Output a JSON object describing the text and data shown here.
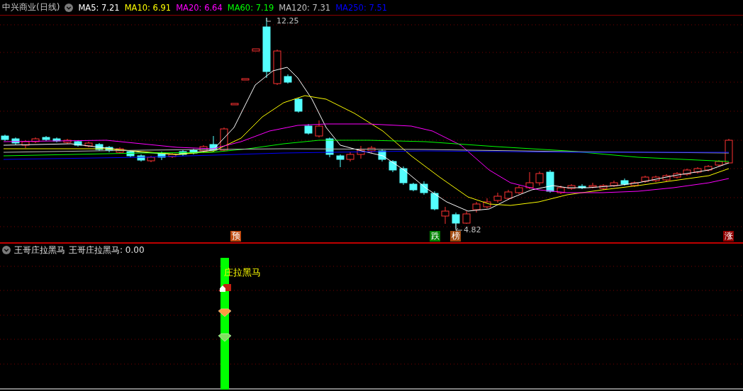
{
  "title": "中兴商业(日线)",
  "ma_legend": [
    {
      "label": "MA5: 7.21",
      "color": "#ffffff"
    },
    {
      "label": "MA10: 6.91",
      "color": "#ffff00"
    },
    {
      "label": "MA20: 6.64",
      "color": "#ff00ff"
    },
    {
      "label": "MA60: 7.19",
      "color": "#00ff00"
    },
    {
      "label": "MA120: 7.31",
      "color": "#c0c0c0"
    },
    {
      "label": "MA250: 7.51",
      "color": "#0000ff"
    }
  ],
  "price_labels": [
    {
      "text": "12.25"
    },
    {
      "text": "4.82"
    }
  ],
  "signal_markers": [
    {
      "text": "预",
      "color": "#c04a10"
    },
    {
      "text": "跌",
      "color": "#008000"
    },
    {
      "text": "榜",
      "color": "#a04a10"
    },
    {
      "text": "涨",
      "color": "#900000"
    }
  ],
  "indicator": {
    "name": "王哥庄拉黑马",
    "value_label": "王哥庄拉黑马: 0.00",
    "bar_label": "庄拉黑马"
  }
}
